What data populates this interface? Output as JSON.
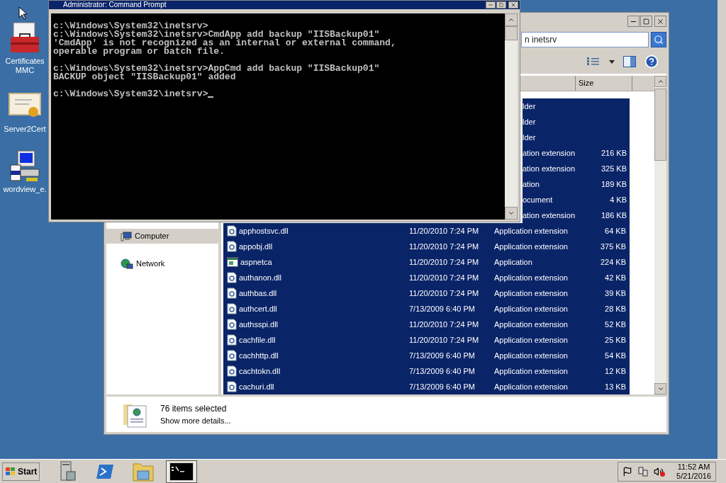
{
  "desktop_icons": [
    {
      "label": "Certificates MMC",
      "kind": "toolbox"
    },
    {
      "label": "Server2Cert",
      "kind": "certificate"
    },
    {
      "label": "wordview_e.",
      "kind": "computer"
    }
  ],
  "console": {
    "title": "Administrator: Command Prompt",
    "blocks": [
      [
        "c:\\Windows\\System32\\inetsrv>",
        "c:\\Windows\\System32\\inetsrv>CmdApp add backup \"IISBackup01\"",
        "'CmdApp' is not recognized as an internal or external command,",
        "operable program or batch file."
      ],
      [
        "c:\\Windows\\System32\\inetsrv>AppCmd add backup \"IISBackup01\"",
        "BACKUP object \"IISBackup01\" added"
      ],
      [
        "c:\\Windows\\System32\\inetsrv>"
      ]
    ]
  },
  "explorer": {
    "search": {
      "placeholder": "n inetsrv"
    },
    "columns": [
      "Size"
    ],
    "nav_items": [
      {
        "label": "Computer",
        "selected": true,
        "kind": "computer"
      },
      {
        "label": "Network",
        "selected": false,
        "kind": "network"
      }
    ],
    "rows": [
      {
        "type": "lder",
        "selected": true
      },
      {
        "type": "lder",
        "selected": true
      },
      {
        "type": "lder",
        "selected": true
      },
      {
        "type": "ation extension",
        "size": "216 KB",
        "selected": true
      },
      {
        "type": "ation extension",
        "size": "325 KB",
        "selected": true
      },
      {
        "type": "ation",
        "size": "189 KB",
        "selected": true
      },
      {
        "type": "ocument",
        "size": "4 KB",
        "selected": true
      },
      {
        "type": "ation extension",
        "size": "186 KB",
        "selected": true
      },
      {
        "kind": "extension",
        "name": "apphostsvc.dll",
        "date": "11/20/2010 7:24 PM",
        "type": "Application extension",
        "size": "64 KB",
        "selected": true
      },
      {
        "kind": "extension",
        "name": "appobj.dll",
        "date": "11/20/2010 7:24 PM",
        "type": "Application extension",
        "size": "375 KB",
        "selected": true
      },
      {
        "kind": "application",
        "name": "aspnetca",
        "date": "11/20/2010 7:24 PM",
        "type": "Application",
        "size": "224 KB",
        "selected": true
      },
      {
        "kind": "extension",
        "name": "authanon.dll",
        "date": "11/20/2010 7:24 PM",
        "type": "Application extension",
        "size": "42 KB",
        "selected": true
      },
      {
        "kind": "extension",
        "name": "authbas.dll",
        "date": "11/20/2010 7:24 PM",
        "type": "Application extension",
        "size": "39 KB",
        "selected": true
      },
      {
        "kind": "extension",
        "name": "authcert.dll",
        "date": "7/13/2009 6:40 PM",
        "type": "Application extension",
        "size": "28 KB",
        "selected": true
      },
      {
        "kind": "extension",
        "name": "authsspi.dll",
        "date": "11/20/2010 7:24 PM",
        "type": "Application extension",
        "size": "52 KB",
        "selected": true
      },
      {
        "kind": "extension",
        "name": "cachfile.dll",
        "date": "11/20/2010 7:24 PM",
        "type": "Application extension",
        "size": "25 KB",
        "selected": true
      },
      {
        "kind": "extension",
        "name": "cachhttp.dll",
        "date": "7/13/2009 6:40 PM",
        "type": "Application extension",
        "size": "54 KB",
        "selected": true
      },
      {
        "kind": "extension",
        "name": "cachtokn.dll",
        "date": "7/13/2009 6:40 PM",
        "type": "Application extension",
        "size": "12 KB",
        "selected": true
      },
      {
        "kind": "extension",
        "name": "cachuri.dll",
        "date": "7/13/2009 6:40 PM",
        "type": "Application extension",
        "size": "13 KB",
        "selected": true
      }
    ],
    "details": {
      "title": "76 items selected",
      "link": "Show more details..."
    }
  },
  "taskbar": {
    "start": "Start",
    "buttons": [
      {
        "kind": "server",
        "selected": false
      },
      {
        "kind": "shell",
        "selected": false
      },
      {
        "kind": "folder",
        "selected": false
      },
      {
        "kind": "console",
        "selected": true
      }
    ],
    "clock": {
      "time": "11:52 AM",
      "date": "5/21/2016"
    }
  }
}
